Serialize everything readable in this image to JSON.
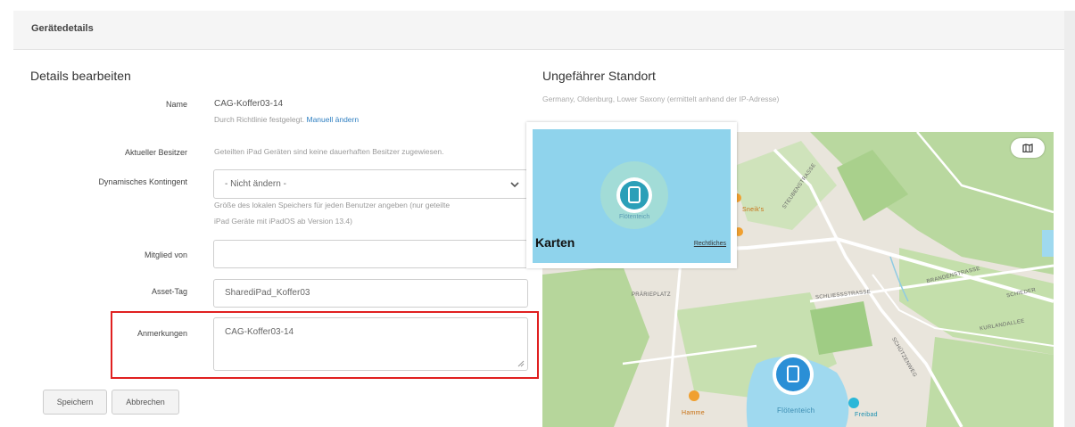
{
  "header": {
    "title": "Gerätedetails"
  },
  "edit": {
    "title": "Details bearbeiten",
    "name_label": "Name",
    "name_value": "CAG-Koffer03-14",
    "name_help": "Durch Richtlinie festgelegt.",
    "name_link": "Manuell ändern",
    "owner_label": "Aktueller Besitzer",
    "owner_help": "Geteilten iPad Geräten sind keine dauerhaften Besitzer zugewiesen.",
    "quota_label": "Dynamisches Kontingent",
    "quota_selected": "- Nicht ändern -",
    "quota_help_1": "Größe des lokalen Speichers für jeden Benutzer angeben (nur geteilte",
    "quota_help_2": "iPad Geräte mit iPadOS ab Version 13.4)",
    "member_label": "Mitglied von",
    "member_value": "",
    "asset_label": "Asset-Tag",
    "asset_value": "SharediPad_Koffer03",
    "notes_label": "Anmerkungen",
    "notes_value": "CAG-Koffer03-14",
    "save_label": "Speichern",
    "cancel_label": "Abbrechen"
  },
  "location": {
    "title": "Ungefährer Standort",
    "subtitle": "Germany, Oldenburg, Lower Saxony (ermittelt anhand der IP-Adresse)",
    "map_toggle": "fill",
    "popup_brand": "Karten",
    "popup_legal": "Rechtliches",
    "popup_place": "Flötenteich",
    "lake_label": "Flötenteich",
    "poi_1": "Hamme",
    "poi_2": "Freibad",
    "poi_3": "Sneik's",
    "street_1": "STEUBENSTRASSE",
    "street_2": "SCHLIESSSTRASSE",
    "street_3": "BRANDENSTRASSE",
    "street_4": "SCHÜTZENWEG",
    "street_5": "KURLANDALLEE",
    "street_6": "SCHIEDER",
    "street_7": "PRÄRIEPLATZ",
    "colors": {
      "highlight": "#e02020",
      "link": "#2f7fc1",
      "water": "#8fd3ec",
      "pin": "#2a8fd6"
    }
  }
}
